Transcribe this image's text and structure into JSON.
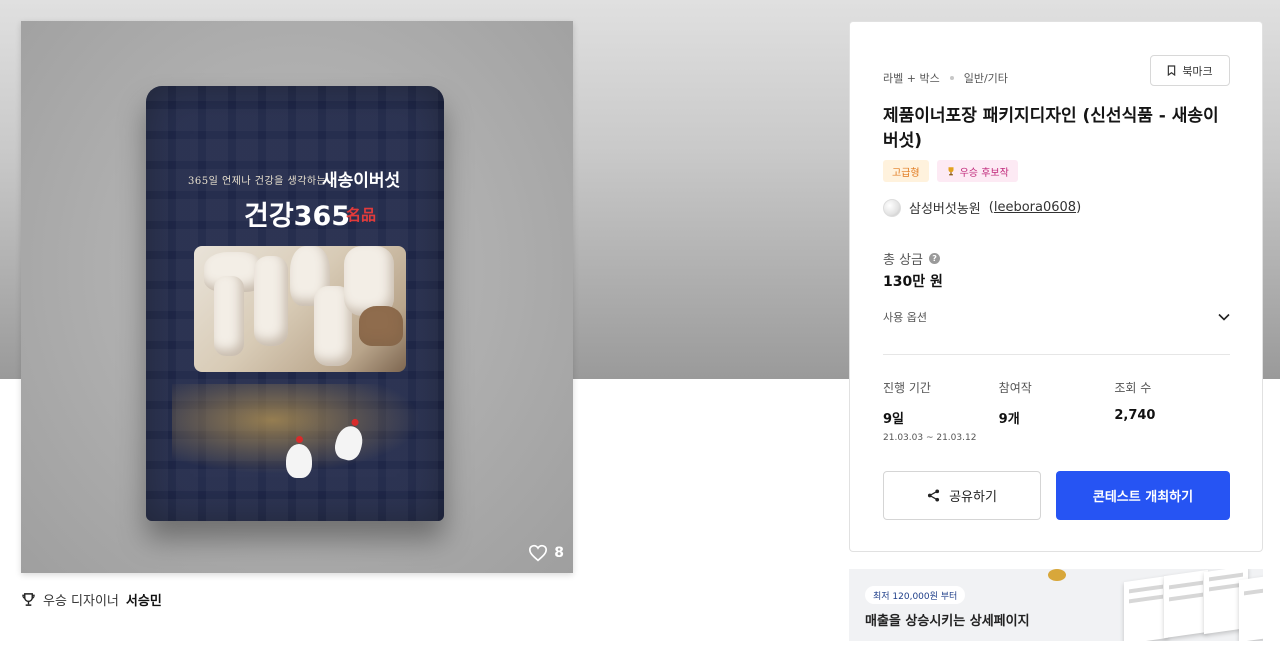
{
  "product": {
    "likes": "8",
    "pouch": {
      "subline": "365일 언제나 건강을 생각하는",
      "brand": "새송이버섯",
      "title": "건강365",
      "seal": "名品"
    }
  },
  "designer": {
    "prefix": "우승 디자이너",
    "name": "서승민"
  },
  "card": {
    "category": "라벨 + 박스",
    "subcategory": "일반/기타",
    "bookmark_label": "북마크",
    "title": "제품이너포장 패키지디자인 (신선식품 - 새송이버섯)",
    "badges": [
      "고급형",
      "우승 후보작"
    ],
    "owner_name": "삼성버섯농원",
    "owner_id": "leebora0608",
    "prize_label": "총 상금",
    "prize_value": "130만 원",
    "options_label": "사용 옵션",
    "stats": [
      {
        "label": "진행 기간",
        "value": "9일",
        "sub": "21.03.03 ~ 21.03.12"
      },
      {
        "label": "참여작",
        "value": "9개",
        "sub": ""
      },
      {
        "label": "조회 수",
        "value": "2,740",
        "sub": ""
      }
    ],
    "share_label": "공유하기",
    "host_label": "콘테스트 개최하기"
  },
  "ad": {
    "pill": "최저 120,000원 부터",
    "text": "매출을 상승시키는 상세페이지"
  },
  "colors": {
    "primary": "#2654f3",
    "premium_badge": "#e07a1f",
    "award_badge": "#c0287a",
    "pouch": "#1f2748"
  }
}
